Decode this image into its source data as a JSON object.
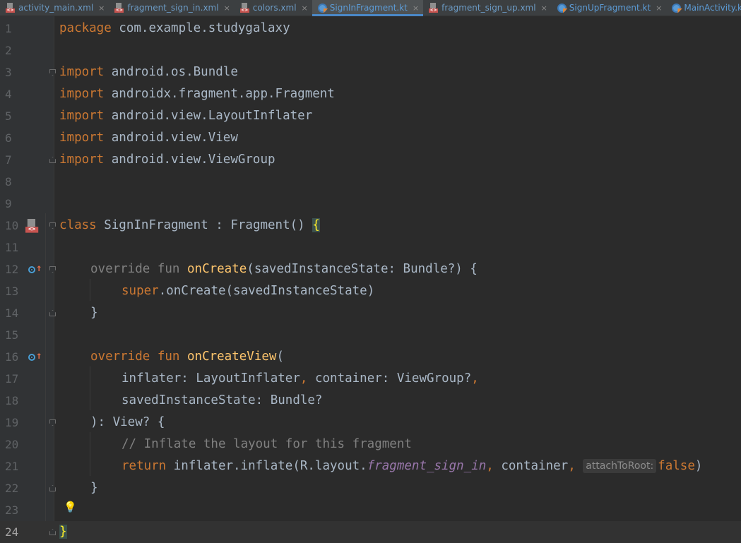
{
  "tabs": [
    {
      "label": "activity_main.xml",
      "type": "xml",
      "active": false
    },
    {
      "label": "fragment_sign_in.xml",
      "type": "xml",
      "active": false
    },
    {
      "label": "colors.xml",
      "type": "xml",
      "active": false
    },
    {
      "label": "SignInFragment.kt",
      "type": "kt",
      "active": true
    },
    {
      "label": "fragment_sign_up.xml",
      "type": "xml",
      "active": false
    },
    {
      "label": "SignUpFragment.kt",
      "type": "kt",
      "active": false
    },
    {
      "label": "MainActivity.kt",
      "type": "kt",
      "active": false
    }
  ],
  "tab_close_glyph": "×",
  "line_numbers": [
    "1",
    "2",
    "3",
    "4",
    "5",
    "6",
    "7",
    "8",
    "9",
    "10",
    "11",
    "12",
    "13",
    "14",
    "15",
    "16",
    "17",
    "18",
    "19",
    "20",
    "21",
    "22",
    "23",
    "24"
  ],
  "current_line": "24",
  "code": {
    "l1": {
      "kw": "package",
      "rest": " com.example.studygalaxy"
    },
    "l3": {
      "kw": "import",
      "rest": " android.os.Bundle"
    },
    "l4": {
      "kw": "import",
      "rest": " androidx.fragment.app.Fragment"
    },
    "l5": {
      "kw": "import",
      "rest": " android.view.LayoutInflater"
    },
    "l6": {
      "kw": "import",
      "rest": " android.view.View"
    },
    "l7": {
      "kw": "import",
      "rest": " android.view.ViewGroup"
    },
    "l10": {
      "kw": "class",
      "rest": " SignInFragment : Fragment() ",
      "brace": "{"
    },
    "l12": {
      "kw1": "override",
      "kw2": "fun",
      "fn": "onCreate",
      "rest": "(savedInstanceState: Bundle?) {"
    },
    "l13": {
      "kw": "super",
      "rest": ".onCreate(savedInstanceState)"
    },
    "l14": {
      "rest": "}"
    },
    "l16": {
      "kw1": "override",
      "kw2": "fun",
      "fn": "onCreateView",
      "rest": "("
    },
    "l17": {
      "a": "inflater: LayoutInflater",
      "comma1": ",",
      "b": " container: ViewGroup?",
      "comma2": ","
    },
    "l18": {
      "rest": "savedInstanceState: Bundle?"
    },
    "l19": {
      "rest": "): View? {"
    },
    "l20": {
      "comment": "// Inflate the layout for this fragment"
    },
    "l21": {
      "kw": "return",
      "a": " inflater.inflate(R.layout.",
      "it": "fragment_sign_in",
      "comma1": ",",
      "b": " container",
      "comma2": ",",
      "hint": "attachToRoot:",
      "kw2": "false",
      "close": ")"
    },
    "l22": {
      "rest": "}"
    },
    "l24": {
      "brace": "}"
    }
  },
  "gutter_icons": {
    "class_icon": "layout-xml-icon",
    "override_icon": "override-method-icon",
    "intention_icon": "lightbulb-icon",
    "arrow_glyph": "↑",
    "bulb_glyph": "💡"
  },
  "colors": {
    "background": "#2b2b2b",
    "keyword": "#cc7832",
    "function": "#ffc66d",
    "comment": "#808080",
    "text": "#a9b7c6",
    "field_italic": "#9876aa"
  }
}
